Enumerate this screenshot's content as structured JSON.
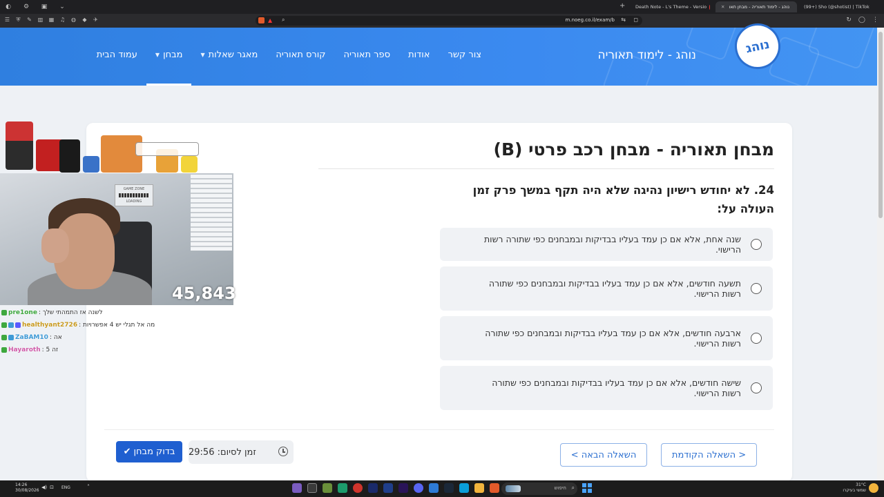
{
  "browser": {
    "tabs": [
      {
        "title": "Death Note - L's Theme - Versio",
        "active": false
      },
      {
        "title": "נוהג - לימוד תאוריה - מבחן תאו",
        "active": true
      },
      {
        "title": "(99+) Sho (@shotist) | TikTok",
        "active": false
      }
    ],
    "url": "m.noeg.co.il/exam/b"
  },
  "site": {
    "brand": "נוהג - לימוד תאוריה",
    "logo_text": "נוהג",
    "nav": [
      {
        "label": "עמוד הבית",
        "has_caret": false,
        "active": false
      },
      {
        "label": "מבחן",
        "has_caret": true,
        "active": true
      },
      {
        "label": "מאגר שאלות",
        "has_caret": true,
        "active": false
      },
      {
        "label": "קורס תאוריה",
        "has_caret": false,
        "active": false
      },
      {
        "label": "ספר תאוריה",
        "has_caret": false,
        "active": false
      },
      {
        "label": "אודות",
        "has_caret": false,
        "active": false
      },
      {
        "label": "צור קשר",
        "has_caret": false,
        "active": false
      }
    ]
  },
  "exam": {
    "title": "מבחן תאוריה - מבחן רכב פרטי (B)",
    "question": "24. לא יחודש רישיון נהיגה שלא היה תקף במשך פרק זמן העולה על:",
    "answers": [
      "שנה אחת, אלא אם כן עמד בעליו בבדיקות ובמבחנים כפי שתורה רשות הרישוי.",
      "תשעה חודשים, אלא אם כן עמד בעליו בבדיקות ובמבחנים כפי שתורה רשות הרישוי.",
      "ארבעה חודשים, אלא אם כן עמד בעליו בבדיקות ובמבחנים כפי שתורה רשות הרישוי.",
      "שישה חודשים, אלא אם כן עמד בעליו בבדיקות ובמבחנים כפי שתורה רשות הרישוי."
    ],
    "prev_label": "< השאלה הקודמת",
    "next_label": "השאלה הבאה >",
    "timer_label": "זמן לסיום: 29:56",
    "check_label": "בדוק מבחן"
  },
  "stream": {
    "viewer_count": "45,843",
    "webcam_overlay": "GAME ZONE",
    "webcam_overlay_sub": "LOADING",
    "chat": [
      {
        "user": "pre1one",
        "color": "#3ea83e",
        "message": ": לשנה אז התמהתי שלך"
      },
      {
        "user": "healthyant2726",
        "color": "#c99a1e",
        "message": ": מה אל תגלי יש 4 אפשרויות"
      },
      {
        "user": "ZaBAM10",
        "color": "#3e9ad6",
        "message": ": אה"
      },
      {
        "user": "Hayaroth",
        "color": "#d05aa8",
        "message": ": 5 זה"
      }
    ]
  },
  "taskbar": {
    "time": "14:26",
    "date": "30/08/2026",
    "lang": "ENG",
    "search_placeholder": "חיפוש",
    "weather_temp": "31°C",
    "weather_desc": "שמשי בעיקרו"
  },
  "colors": {
    "header": "#3b8af0",
    "primary_button": "#1f5fd0",
    "outline_button": "#2b6fd0"
  }
}
